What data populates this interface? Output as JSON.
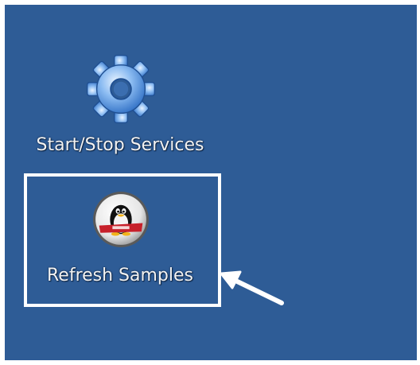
{
  "desktop": {
    "background_color": "#2e5c96",
    "icons": [
      {
        "label": "Start/Stop Services",
        "icon": "gear-icon"
      },
      {
        "label": "Refresh Samples",
        "icon": "oracle-linux-penguin-icon"
      }
    ]
  },
  "annotation": {
    "highlight_color": "#ffffff",
    "arrow_icon": "arrow-icon"
  }
}
